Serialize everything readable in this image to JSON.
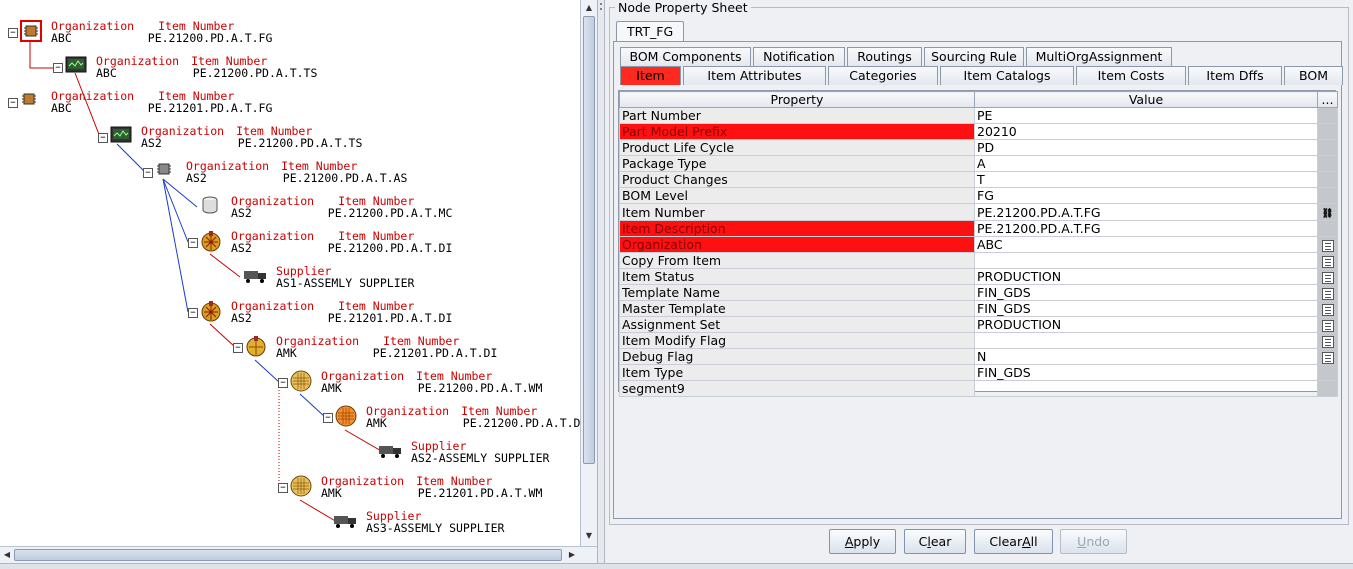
{
  "tree": {
    "label_org": "Organization",
    "label_item": "Item Number",
    "label_supplier": "Supplier",
    "nodes": [
      {
        "kind": "item",
        "org": "ABC",
        "item": "PE.21200.PD.A.T.FG",
        "icon": "chip-icon",
        "selected": true
      },
      {
        "kind": "item",
        "org": "ABC",
        "item": "PE.21200.PD.A.T.TS",
        "icon": "tester-icon"
      },
      {
        "kind": "item",
        "org": "ABC",
        "item": "PE.21201.PD.A.T.FG",
        "icon": "chip-icon"
      },
      {
        "kind": "item",
        "org": "AS2",
        "item": "PE.21200.PD.A.T.TS",
        "icon": "tester-icon"
      },
      {
        "kind": "item",
        "org": "AS2",
        "item": "PE.21200.PD.A.T.AS",
        "icon": "chip-icon"
      },
      {
        "kind": "item",
        "org": "AS2",
        "item": "PE.21200.PD.A.T.MC",
        "icon": "cylinder-icon"
      },
      {
        "kind": "item",
        "org": "AS2",
        "item": "PE.21200.PD.A.T.DI",
        "icon": "die-icon"
      },
      {
        "kind": "supplier",
        "name": "AS1-ASSEMLY SUPPLIER",
        "icon": "truck-icon"
      },
      {
        "kind": "item",
        "org": "AS2",
        "item": "PE.21201.PD.A.T.DI",
        "icon": "die-icon"
      },
      {
        "kind": "item",
        "org": "AMK",
        "item": "PE.21201.PD.A.T.DI",
        "icon": "die-icon"
      },
      {
        "kind": "item",
        "org": "AMK",
        "item": "PE.21200.PD.A.T.WM",
        "icon": "wafer-icon"
      },
      {
        "kind": "item",
        "org": "AMK",
        "item": "PE.21200.PD.A.T.D",
        "icon": "wafer-orange-icon"
      },
      {
        "kind": "supplier",
        "name": "AS2-ASSEMLY SUPPLIER",
        "icon": "truck-icon"
      },
      {
        "kind": "item",
        "org": "AMK",
        "item": "PE.21201.PD.A.T.WM",
        "icon": "wafer-icon"
      },
      {
        "kind": "supplier",
        "name": "AS3-ASSEMLY SUPPLIER",
        "icon": "truck-icon"
      }
    ]
  },
  "panel": {
    "title": "Node Property Sheet",
    "node_tab": "TRT_FG",
    "tabs_row1": [
      "BOM Components",
      "Notification",
      "Routings",
      "Sourcing Rule",
      "MultiOrgAssignment"
    ],
    "tabs_row2": [
      "Item",
      "Item Attributes",
      "Categories",
      "Item Catalogs",
      "Item Costs",
      "Item Dffs",
      "BOM"
    ],
    "active_tab": "Item",
    "table": {
      "col_property": "Property",
      "col_value": "Value",
      "col_more": "...",
      "rows": [
        {
          "property": "Part Number",
          "value": "PE",
          "required": false,
          "button": ""
        },
        {
          "property": "Part Model Prefix",
          "value": "20210",
          "required": true,
          "button": ""
        },
        {
          "property": "Product Life Cycle",
          "value": "PD",
          "required": false,
          "button": ""
        },
        {
          "property": "Package Type",
          "value": "A",
          "required": false,
          "button": ""
        },
        {
          "property": "Product Changes",
          "value": "T",
          "required": false,
          "button": ""
        },
        {
          "property": "BOM Level",
          "value": "FG",
          "required": false,
          "button": ""
        },
        {
          "property": "Item Number",
          "value": "PE.21200.PD.A.T.FG",
          "required": false,
          "button": "link"
        },
        {
          "property": "Item Description",
          "value": "PE.21200.PD.A.T.FG",
          "required": true,
          "button": ""
        },
        {
          "property": "Organization",
          "value": "ABC",
          "required": true,
          "button": "lov"
        },
        {
          "property": "Copy From Item",
          "value": "",
          "required": false,
          "button": "lov"
        },
        {
          "property": "Item Status",
          "value": "PRODUCTION",
          "required": false,
          "button": "lov"
        },
        {
          "property": "Template Name",
          "value": "FIN_GDS",
          "required": false,
          "button": "lov"
        },
        {
          "property": "Master Template",
          "value": "FIN_GDS",
          "required": false,
          "button": "lov"
        },
        {
          "property": "Assignment Set",
          "value": "PRODUCTION",
          "required": false,
          "button": "lov"
        },
        {
          "property": "Item Modify Flag",
          "value": "",
          "required": false,
          "button": "lov"
        },
        {
          "property": "Debug Flag",
          "value": "N",
          "required": false,
          "button": "lov"
        },
        {
          "property": "Item Type",
          "value": "FIN_GDS",
          "required": false,
          "button": ""
        },
        {
          "property": "segment9",
          "value": "",
          "required": false,
          "button": ""
        }
      ]
    },
    "buttons": {
      "apply": "Apply",
      "clear": "Clear",
      "clearall": "ClearAll",
      "undo": "Undo"
    }
  },
  "colors": {
    "required": "#ff1010",
    "active_tab": "#ff2a1f",
    "tree_label": "#cc0000"
  }
}
